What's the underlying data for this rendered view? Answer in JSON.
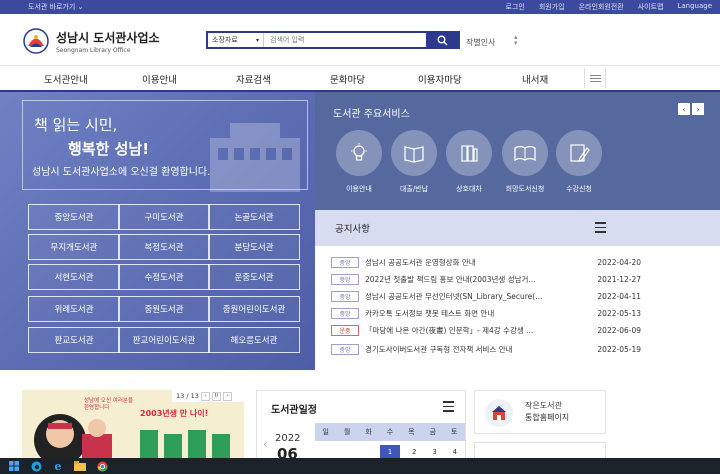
{
  "topbar": {
    "goto_label": "도서관 바로가기",
    "links": [
      "로그인",
      "회원가입",
      "온라인회원전환",
      "사이트맵",
      "Language"
    ]
  },
  "header": {
    "logo_title": "성남시 도서관사업소",
    "logo_subtitle": "Seongnam Library Office",
    "search_select": "소장자료",
    "search_placeholder": "검색어 입력",
    "popular_label": "작별인사"
  },
  "nav": {
    "items": [
      "도서관안내",
      "이용안내",
      "자료검색",
      "문화마당",
      "이용자마당",
      "내서재"
    ]
  },
  "hero": {
    "line1": "책 읽는 시민,",
    "line2": "행복한 성남!",
    "line3": "성남시 도서관사업소에 오신걸 환영합니다.",
    "libraries": [
      "중앙도서관",
      "구미도서관",
      "논골도서관",
      "무지개도서관",
      "복정도서관",
      "분당도서관",
      "서현도서관",
      "수정도서관",
      "운중도서관",
      "위례도서관",
      "중원도서관",
      "중원어린이도서관",
      "판교도서관",
      "판교어린이도서관",
      "해오름도서관"
    ]
  },
  "services": {
    "title": "도서관 주요서비스",
    "items": [
      {
        "label": "이용안내",
        "icon": "lightbulb-icon"
      },
      {
        "label": "대출/반납",
        "icon": "book-icon"
      },
      {
        "label": "상호대차",
        "icon": "books-exchange-icon"
      },
      {
        "label": "희망도서신청",
        "icon": "open-book-icon"
      },
      {
        "label": "수강신청",
        "icon": "pencil-icon"
      }
    ]
  },
  "notice": {
    "title": "공지사항",
    "rows": [
      {
        "tag": "중앙",
        "text": "성남시 공공도서관 운영형상화 안내",
        "date": "2022-04-20",
        "red": false
      },
      {
        "tag": "중앙",
        "text": "2022년 첫출발 책드림 홍보 안내(2003년생 성남거...",
        "date": "2021-12-27",
        "red": false
      },
      {
        "tag": "중앙",
        "text": "성남시 공공도서관 무선인터넷(SN_Library_Secure(...",
        "date": "2022-04-11",
        "red": false
      },
      {
        "tag": "중앙",
        "text": "카카오톡 도서정보 챗봇 테스트 화면 안내",
        "date": "2022-05-13",
        "red": false
      },
      {
        "tag": "운중",
        "text": "「마당에 나온 아간(夜晝) 인문학」- 제4강 수강생 ...",
        "date": "2022-06-09",
        "red": true
      },
      {
        "tag": "중앙",
        "text": "경기도사이버도서관 구독형 전자책 서비스 안내",
        "date": "2022-05-19",
        "red": false
      }
    ]
  },
  "banner": {
    "pager": "13 / 13",
    "text1": "2003년생 만 나이!",
    "text2": "성남에 오신 여러분을 환영합니다"
  },
  "schedule": {
    "title": "도서관일정",
    "year": "2022",
    "month": "06",
    "weekdays": [
      "일",
      "월",
      "화",
      "수",
      "목",
      "금",
      "토"
    ],
    "days": [
      "",
      "",
      "",
      "1",
      "2",
      "3",
      "4"
    ]
  },
  "quick": {
    "line1": "작은도서관",
    "line2": "통합홈페이지"
  },
  "colors": {
    "accent": "#2d3a8c",
    "hero": "#6374b8",
    "services": "#56699f",
    "notice_head": "#d8dcf0"
  }
}
